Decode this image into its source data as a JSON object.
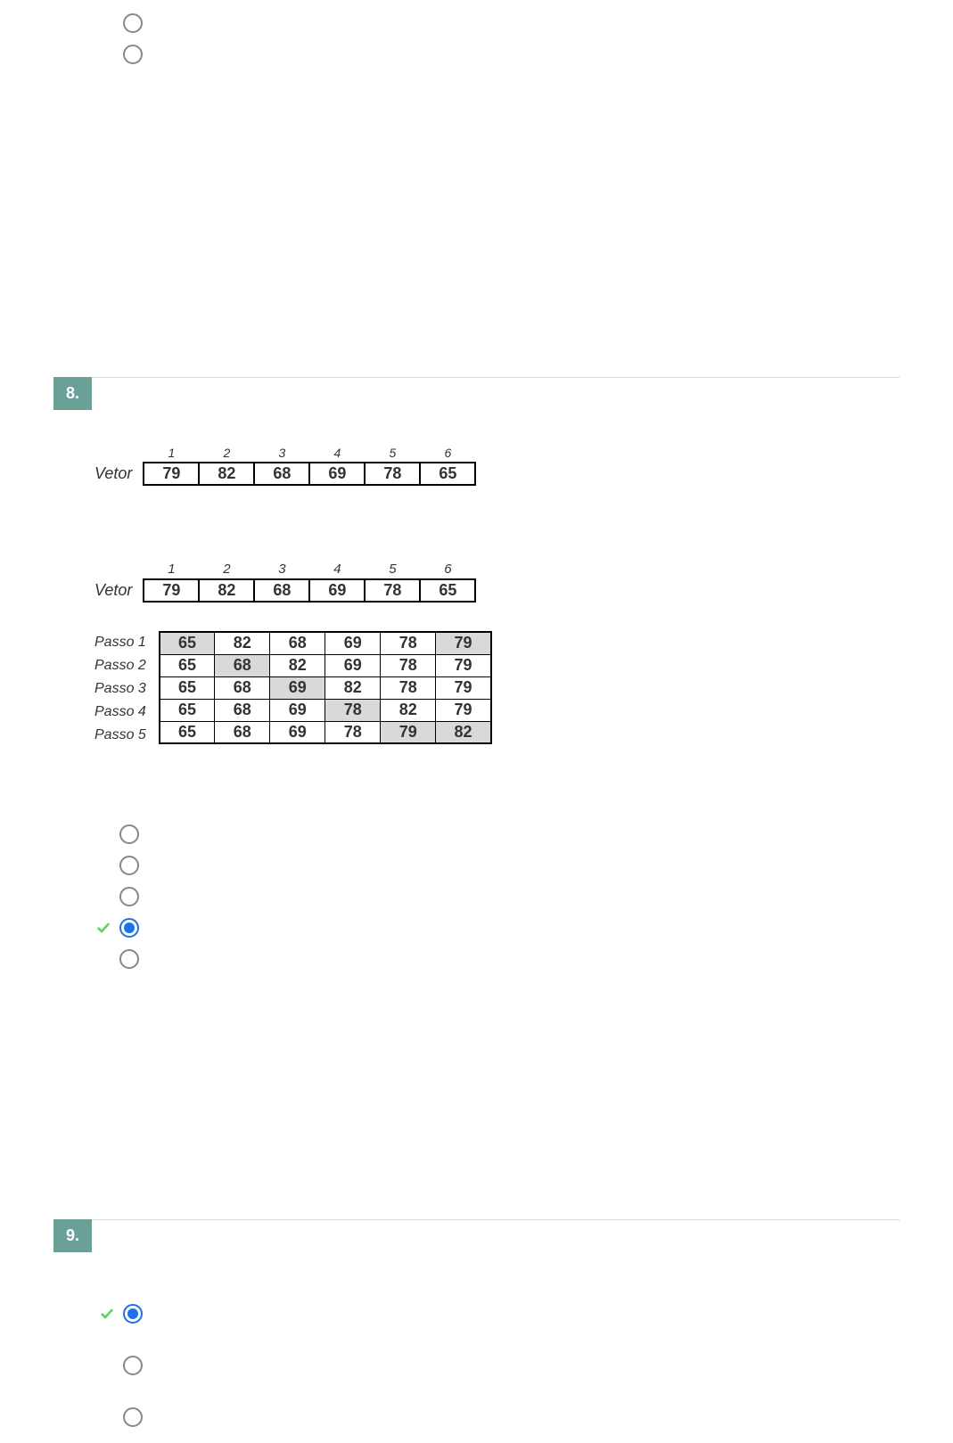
{
  "q7": {
    "options": [
      {
        "correct": false,
        "selected": false
      },
      {
        "correct": false,
        "selected": false
      }
    ]
  },
  "q8": {
    "number": "8.",
    "vetor1": {
      "label": "Vetor",
      "indices": [
        "1",
        "2",
        "3",
        "4",
        "5",
        "6"
      ],
      "values": [
        "79",
        "82",
        "68",
        "69",
        "78",
        "65"
      ]
    },
    "vetor2": {
      "label": "Vetor",
      "indices": [
        "1",
        "2",
        "3",
        "4",
        "5",
        "6"
      ],
      "values": [
        "79",
        "82",
        "68",
        "69",
        "78",
        "65"
      ]
    },
    "passos": {
      "labels": [
        "Passo 1",
        "Passo 2",
        "Passo 3",
        "Passo 4",
        "Passo 5"
      ],
      "rows": [
        {
          "cells": [
            "65",
            "82",
            "68",
            "69",
            "78",
            "79"
          ],
          "hl": [
            0,
            5
          ]
        },
        {
          "cells": [
            "65",
            "68",
            "82",
            "69",
            "78",
            "79"
          ],
          "hl": [
            1
          ]
        },
        {
          "cells": [
            "65",
            "68",
            "69",
            "82",
            "78",
            "79"
          ],
          "hl": [
            2
          ]
        },
        {
          "cells": [
            "65",
            "68",
            "69",
            "78",
            "82",
            "79"
          ],
          "hl": [
            3
          ]
        },
        {
          "cells": [
            "65",
            "68",
            "69",
            "78",
            "79",
            "82"
          ],
          "hl": [
            4,
            5
          ]
        }
      ]
    },
    "options": [
      {
        "correct": false,
        "selected": false
      },
      {
        "correct": false,
        "selected": false
      },
      {
        "correct": false,
        "selected": false
      },
      {
        "correct": true,
        "selected": true
      },
      {
        "correct": false,
        "selected": false
      }
    ]
  },
  "q9": {
    "number": "9.",
    "options": [
      {
        "correct": true,
        "selected": true
      },
      {
        "correct": false,
        "selected": false
      },
      {
        "correct": false,
        "selected": false
      }
    ]
  }
}
